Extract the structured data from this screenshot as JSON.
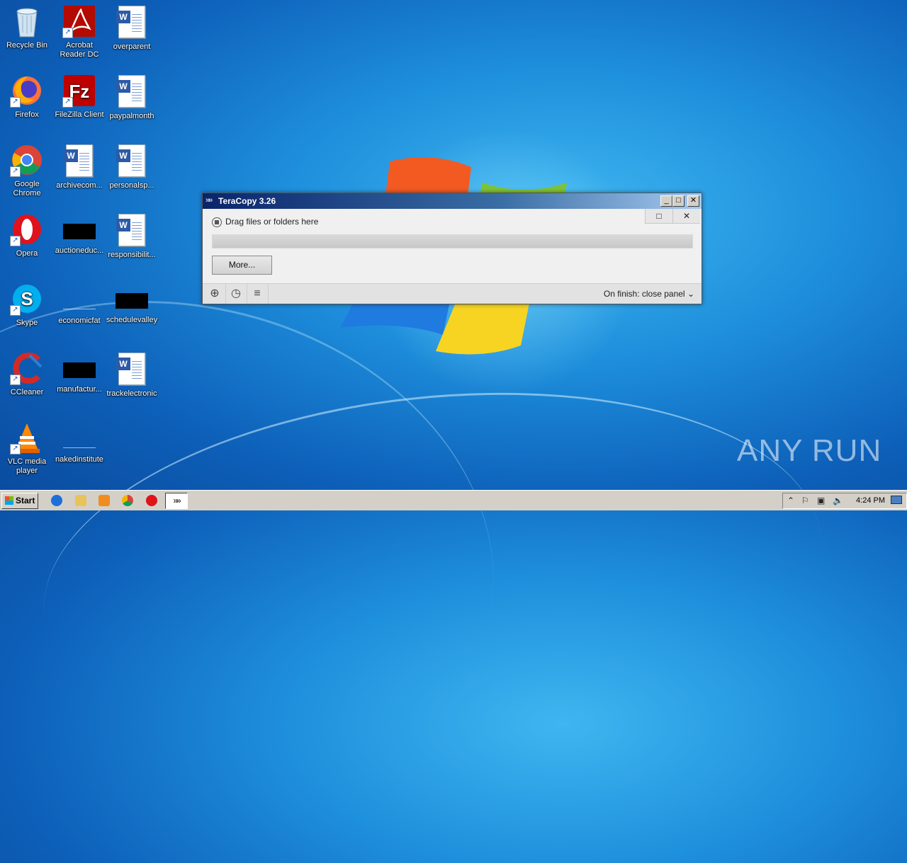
{
  "desktop": {
    "icons": [
      {
        "label": "Recycle Bin"
      },
      {
        "label": "Acrobat Reader DC"
      },
      {
        "label": "overparent"
      },
      {
        "label": "Firefox"
      },
      {
        "label": "FileZilla Client"
      },
      {
        "label": "paypalmonth"
      },
      {
        "label": "Google Chrome"
      },
      {
        "label": "archivecom..."
      },
      {
        "label": "personalsp..."
      },
      {
        "label": "Opera"
      },
      {
        "label": "auctioneduc..."
      },
      {
        "label": "responsibilit..."
      },
      {
        "label": "Skype"
      },
      {
        "label": "economicfat"
      },
      {
        "label": "schedulevalley"
      },
      {
        "label": "CCleaner"
      },
      {
        "label": "manufactur..."
      },
      {
        "label": "trackelectronic"
      },
      {
        "label": "VLC media player"
      },
      {
        "label": "nakedinstitute"
      }
    ]
  },
  "window": {
    "title": "TeraCopy 3.26",
    "status_text": "Drag files or folders here",
    "more_button": "More...",
    "on_finish": "On finish: close panel",
    "title_buttons": {
      "minimize": "_",
      "maximize": "□",
      "close": "✕"
    },
    "sub_buttons": {
      "restore": "□",
      "close": "✕"
    }
  },
  "taskbar": {
    "start_label": "Start",
    "clock": "4:24 PM"
  },
  "watermark": "ANY RUN"
}
